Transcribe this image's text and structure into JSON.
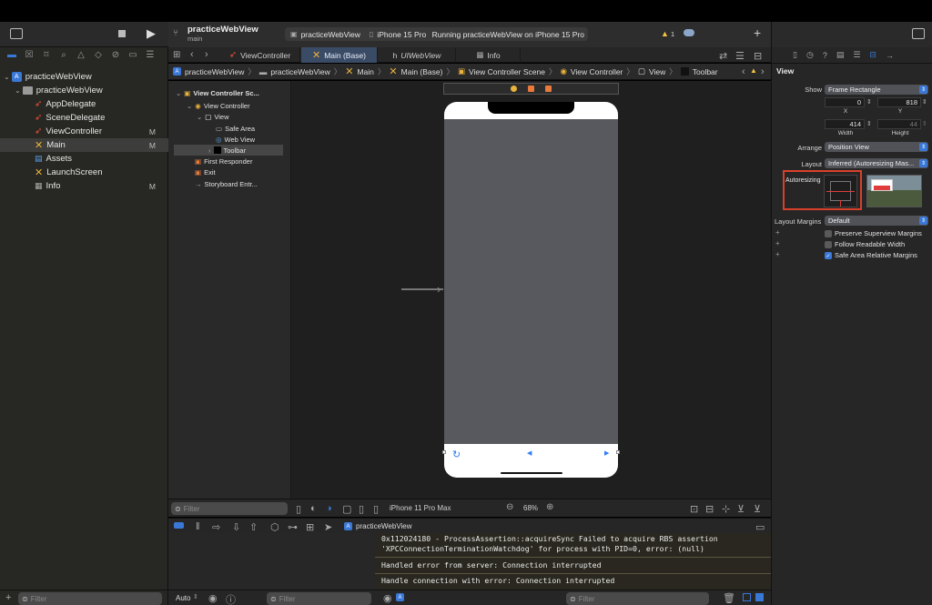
{
  "toolbar": {
    "project_name": "practiceWebView",
    "branch": "main",
    "scheme": "practiceWebView",
    "device": "iPhone 15 Pro",
    "status": "Running practiceWebView on iPhone 15 Pro",
    "warning_count": "1"
  },
  "navigator": {
    "filter_placeholder": "Filter",
    "items": [
      {
        "label": "practiceWebView",
        "icon": "project-icon",
        "badge": ""
      },
      {
        "label": "practiceWebView",
        "icon": "folder-icon",
        "badge": ""
      },
      {
        "label": "AppDelegate",
        "icon": "swift-icon",
        "badge": ""
      },
      {
        "label": "SceneDelegate",
        "icon": "swift-icon",
        "badge": ""
      },
      {
        "label": "ViewController",
        "icon": "swift-icon",
        "badge": "M"
      },
      {
        "label": "Main",
        "icon": "storyboard-icon",
        "badge": "M"
      },
      {
        "label": "Assets",
        "icon": "assets-icon",
        "badge": ""
      },
      {
        "label": "LaunchScreen",
        "icon": "storyboard-icon",
        "badge": ""
      },
      {
        "label": "Info",
        "icon": "plist-icon",
        "badge": "M"
      }
    ]
  },
  "tabs": [
    {
      "label": "ViewController"
    },
    {
      "label": "Main (Base)"
    },
    {
      "label": "UIWebView"
    },
    {
      "label": "Info"
    }
  ],
  "jumpbar": [
    "practiceWebView",
    "practiceWebView",
    "Main",
    "Main (Base)",
    "View Controller Scene",
    "View Controller",
    "View",
    "Toolbar"
  ],
  "outline": {
    "items": [
      {
        "label": "View Controller Sc..."
      },
      {
        "label": "View Controller"
      },
      {
        "label": "View"
      },
      {
        "label": "Safe Area"
      },
      {
        "label": "Web View"
      },
      {
        "label": "Toolbar"
      },
      {
        "label": "First Responder"
      },
      {
        "label": "Exit"
      },
      {
        "label": "Storyboard Entr..."
      }
    ],
    "filter_placeholder": "Filter"
  },
  "canvas": {
    "device_label": "iPhone 11 Pro Max",
    "zoom": "68%"
  },
  "debug": {
    "target": "practiceWebView",
    "auto_label": "Auto",
    "filter_placeholder": "Filter",
    "console_filter_placeholder": "Filter",
    "logs": [
      "0x112024180 - ProcessAssertion::acquireSync Failed to acquire RBS assertion\n'XPCConnectionTerminationWatchdog' for process with PID=0, error: (null)",
      "Handled error from server: Connection interrupted",
      "Handle connection with error: Connection interrupted"
    ]
  },
  "inspector": {
    "section_title": "View",
    "show_label": "Show",
    "show_value": "Frame Rectangle",
    "x_value": "0",
    "y_value": "818",
    "x_label": "X",
    "y_label": "Y",
    "width_value": "414",
    "height_value": "44",
    "width_label": "Width",
    "height_label": "Height",
    "arrange_label": "Arrange",
    "arrange_value": "Position View",
    "layout_label": "Layout",
    "layout_value": "Inferred (Autoresizing Mas...",
    "autoresizing_label": "Autoresizing",
    "layout_margins_label": "Layout Margins",
    "layout_margins_value": "Default",
    "checkboxes": [
      {
        "label": "Preserve Superview Margins",
        "checked": false
      },
      {
        "label": "Follow Readable Width",
        "checked": false
      },
      {
        "label": "Safe Area Relative Margins",
        "checked": true
      }
    ]
  },
  "colors": {
    "accent": "#3a78d8",
    "highlight_box": "#d9402b",
    "swift": "#f05138",
    "storyboard": "#e9b23b"
  }
}
